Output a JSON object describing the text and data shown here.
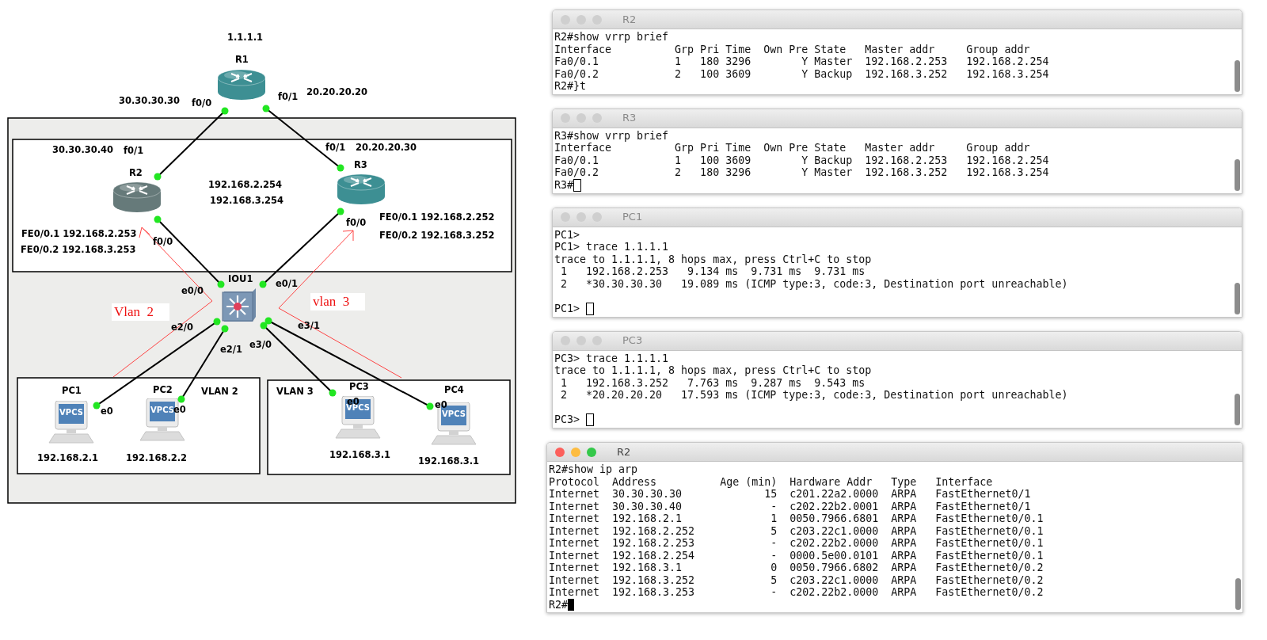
{
  "diagram": {
    "nodes": [
      {
        "name": "R1",
        "kind": "router",
        "color": "#3d8f93"
      },
      {
        "name": "R2",
        "kind": "router",
        "color": "#667a7a"
      },
      {
        "name": "R3",
        "kind": "router",
        "color": "#3d8f93"
      },
      {
        "name": "IOU1",
        "kind": "switch"
      },
      {
        "name": "PC1",
        "kind": "pc",
        "badge": "VPCS"
      },
      {
        "name": "PC2",
        "kind": "pc",
        "badge": "VPCS"
      },
      {
        "name": "PC3",
        "kind": "pc",
        "badge": "VPCS"
      },
      {
        "name": "PC4",
        "kind": "pc",
        "badge": "VPCS"
      }
    ],
    "labels": [
      {
        "text": "1.1.1.1",
        "kind": "address"
      },
      {
        "text": "30.30.30.30",
        "kind": "address"
      },
      {
        "text": "f0/0",
        "kind": "port"
      },
      {
        "text": "f0/1",
        "kind": "port"
      },
      {
        "text": "20.20.20.20",
        "kind": "address"
      },
      {
        "text": "30.30.30.40",
        "kind": "address"
      },
      {
        "text": "f0/1",
        "kind": "port"
      },
      {
        "text": "f0/1",
        "kind": "port"
      },
      {
        "text": "20.20.20.30",
        "kind": "address"
      },
      {
        "text": "192.168.2.254",
        "kind": "address"
      },
      {
        "text": "192.168.3.254",
        "kind": "address"
      },
      {
        "text": "FE0/0.1 192.168.2.253",
        "kind": "address"
      },
      {
        "text": "FE0/0.2 192.168.3.253",
        "kind": "address"
      },
      {
        "text": "f0/0",
        "kind": "port"
      },
      {
        "text": "f0/0",
        "kind": "port"
      },
      {
        "text": "FE0/0.1 192.168.2.252",
        "kind": "address"
      },
      {
        "text": "FE0/0.2 192.168.3.252",
        "kind": "address"
      },
      {
        "text": "e0/0",
        "kind": "port"
      },
      {
        "text": "e0/1",
        "kind": "port"
      },
      {
        "text": "Vlan  2",
        "kind": "note"
      },
      {
        "text": "vlan  3",
        "kind": "note"
      },
      {
        "text": "e2/0",
        "kind": "port"
      },
      {
        "text": "e3/1",
        "kind": "port"
      },
      {
        "text": "e2/1",
        "kind": "port"
      },
      {
        "text": "e3/0",
        "kind": "port"
      },
      {
        "text": "VLAN 2",
        "kind": "vlan"
      },
      {
        "text": "VLAN 3",
        "kind": "vlan"
      },
      {
        "text": "e0",
        "kind": "port"
      },
      {
        "text": "e0",
        "kind": "port"
      },
      {
        "text": "e0",
        "kind": "port"
      },
      {
        "text": "e0",
        "kind": "port"
      },
      {
        "text": "192.168.2.1",
        "kind": "address"
      },
      {
        "text": "192.168.2.2",
        "kind": "address"
      },
      {
        "text": "192.168.3.1",
        "kind": "address"
      },
      {
        "text": "192.168.3.1",
        "kind": "address"
      }
    ]
  },
  "terminals": [
    {
      "title": "R2",
      "kind": "ios",
      "focused": false,
      "lines": [
        "R2#show vrrp brief",
        "Interface          Grp Pri Time  Own Pre State   Master addr     Group addr",
        "Fa0/0.1            1   180 3296        Y Master  192.168.2.253   192.168.2.254",
        "Fa0/0.2            2   100 3609        Y Backup  192.168.3.252   192.168.3.254"
      ],
      "prompt": "R2#}t",
      "cursor": false
    },
    {
      "title": "R3",
      "kind": "ios",
      "focused": false,
      "lines": [
        "R3#show vrrp brief",
        "Interface          Grp Pri Time  Own Pre State   Master addr     Group addr",
        "Fa0/0.1            1   100 3609        Y Backup  192.168.2.253   192.168.2.254",
        "Fa0/0.2            2   180 3296        Y Master  192.168.3.252   192.168.3.254"
      ],
      "prompt": "R3#",
      "cursor": true
    },
    {
      "title": "PC1",
      "kind": "vpcs",
      "focused": false,
      "lines": [
        "PC1>",
        "PC1> trace 1.1.1.1",
        "trace to 1.1.1.1, 8 hops max, press Ctrl+C to stop",
        " 1   192.168.2.253   9.134 ms  9.731 ms  9.731 ms",
        " 2   *30.30.30.30   19.089 ms (ICMP type:3, code:3, Destination port unreachable)"
      ],
      "prompt": "PC1> ",
      "cursor": true
    },
    {
      "title": "PC3",
      "kind": "vpcs",
      "focused": false,
      "lines": [
        "PC3> trace 1.1.1.1",
        "trace to 1.1.1.1, 8 hops max, press Ctrl+C to stop",
        " 1   192.168.3.252   7.763 ms  9.287 ms  9.543 ms",
        " 2   *20.20.20.20   17.593 ms (ICMP type:3, code:3, Destination port unreachable)"
      ],
      "prompt": "PC3> ",
      "cursor": true
    },
    {
      "title": "R2",
      "kind": "ios",
      "focused": true,
      "lines": [
        "R2#show ip arp",
        "Protocol  Address          Age (min)  Hardware Addr   Type   Interface",
        "Internet  30.30.30.30             15  c201.22a2.0000  ARPA   FastEthernet0/1",
        "Internet  30.30.30.40              -  c202.22b2.0001  ARPA   FastEthernet0/1",
        "Internet  192.168.2.1              1  0050.7966.6801  ARPA   FastEthernet0/0.1",
        "Internet  192.168.2.252            5  c203.22c1.0000  ARPA   FastEthernet0/0.1",
        "Internet  192.168.2.253            -  c202.22b2.0000  ARPA   FastEthernet0/0.1",
        "Internet  192.168.2.254            -  0000.5e00.0101  ARPA   FastEthernet0/0.1",
        "Internet  192.168.3.1              0  0050.7966.6802  ARPA   FastEthernet0/0.2",
        "Internet  192.168.3.252            5  c203.22c1.0000  ARPA   FastEthernet0/0.2",
        "Internet  192.168.3.253            -  c202.22b2.0000  ARPA   FastEthernet0/0.2"
      ],
      "prompt": "R2#",
      "cursor": true
    }
  ]
}
